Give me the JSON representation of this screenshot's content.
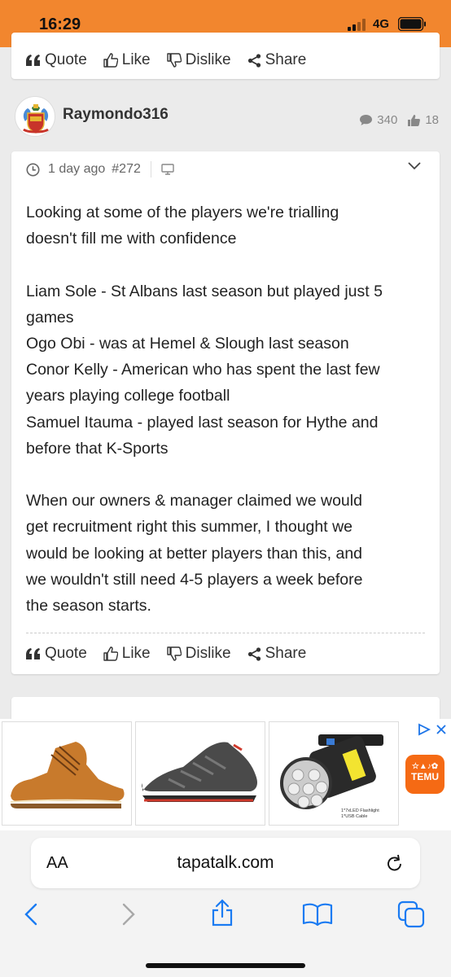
{
  "status": {
    "time": "16:29",
    "network": "4G"
  },
  "prev_post": {
    "actions": {
      "quote": "Quote",
      "like": "Like",
      "dislike": "Dislike",
      "share": "Share"
    }
  },
  "post": {
    "username": "Raymondo316",
    "posts_count": "340",
    "likes_count": "18",
    "time_ago": "1 day ago",
    "post_number": "#272",
    "lines": [
      "Looking at some of the players we're trialling",
      "doesn't fill me with confidence",
      "",
      "Liam Sole - St Albans last season but played just 5",
      "games",
      "Ogo Obi - was at Hemel & Slough last season",
      "Conor Kelly - American who has spent the last few",
      "years playing college football",
      "Samuel Itauma - played last season for Hythe and",
      "before that K-Sports",
      "",
      "When our owners & manager claimed we would",
      "get recruitment right this summer, I thought we",
      "would be looking at better players than this, and",
      "we wouldn't still need 4-5 players a week before",
      "the season starts."
    ],
    "actions": {
      "quote": "Quote",
      "like": "Like",
      "dislike": "Dislike",
      "share": "Share"
    }
  },
  "ad": {
    "product_caption": "1*7xLED Flashlight 1*USB Cable",
    "brand": "TEMU"
  },
  "browser": {
    "aa": "AA",
    "url": "tapatalk.com"
  },
  "colors": {
    "accent": "#f2862e",
    "ad_choice": "#1a73e8",
    "temu": "#f56a14"
  }
}
